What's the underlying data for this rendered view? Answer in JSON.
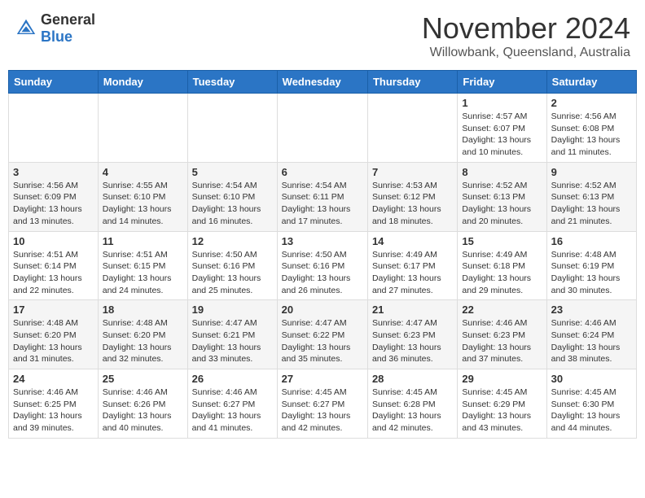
{
  "header": {
    "logo_general": "General",
    "logo_blue": "Blue",
    "month_title": "November 2024",
    "location": "Willowbank, Queensland, Australia"
  },
  "days_of_week": [
    "Sunday",
    "Monday",
    "Tuesday",
    "Wednesday",
    "Thursday",
    "Friday",
    "Saturday"
  ],
  "weeks": [
    [
      {
        "day": "",
        "info": ""
      },
      {
        "day": "",
        "info": ""
      },
      {
        "day": "",
        "info": ""
      },
      {
        "day": "",
        "info": ""
      },
      {
        "day": "",
        "info": ""
      },
      {
        "day": "1",
        "info": "Sunrise: 4:57 AM\nSunset: 6:07 PM\nDaylight: 13 hours and 10 minutes."
      },
      {
        "day": "2",
        "info": "Sunrise: 4:56 AM\nSunset: 6:08 PM\nDaylight: 13 hours and 11 minutes."
      }
    ],
    [
      {
        "day": "3",
        "info": "Sunrise: 4:56 AM\nSunset: 6:09 PM\nDaylight: 13 hours and 13 minutes."
      },
      {
        "day": "4",
        "info": "Sunrise: 4:55 AM\nSunset: 6:10 PM\nDaylight: 13 hours and 14 minutes."
      },
      {
        "day": "5",
        "info": "Sunrise: 4:54 AM\nSunset: 6:10 PM\nDaylight: 13 hours and 16 minutes."
      },
      {
        "day": "6",
        "info": "Sunrise: 4:54 AM\nSunset: 6:11 PM\nDaylight: 13 hours and 17 minutes."
      },
      {
        "day": "7",
        "info": "Sunrise: 4:53 AM\nSunset: 6:12 PM\nDaylight: 13 hours and 18 minutes."
      },
      {
        "day": "8",
        "info": "Sunrise: 4:52 AM\nSunset: 6:13 PM\nDaylight: 13 hours and 20 minutes."
      },
      {
        "day": "9",
        "info": "Sunrise: 4:52 AM\nSunset: 6:13 PM\nDaylight: 13 hours and 21 minutes."
      }
    ],
    [
      {
        "day": "10",
        "info": "Sunrise: 4:51 AM\nSunset: 6:14 PM\nDaylight: 13 hours and 22 minutes."
      },
      {
        "day": "11",
        "info": "Sunrise: 4:51 AM\nSunset: 6:15 PM\nDaylight: 13 hours and 24 minutes."
      },
      {
        "day": "12",
        "info": "Sunrise: 4:50 AM\nSunset: 6:16 PM\nDaylight: 13 hours and 25 minutes."
      },
      {
        "day": "13",
        "info": "Sunrise: 4:50 AM\nSunset: 6:16 PM\nDaylight: 13 hours and 26 minutes."
      },
      {
        "day": "14",
        "info": "Sunrise: 4:49 AM\nSunset: 6:17 PM\nDaylight: 13 hours and 27 minutes."
      },
      {
        "day": "15",
        "info": "Sunrise: 4:49 AM\nSunset: 6:18 PM\nDaylight: 13 hours and 29 minutes."
      },
      {
        "day": "16",
        "info": "Sunrise: 4:48 AM\nSunset: 6:19 PM\nDaylight: 13 hours and 30 minutes."
      }
    ],
    [
      {
        "day": "17",
        "info": "Sunrise: 4:48 AM\nSunset: 6:20 PM\nDaylight: 13 hours and 31 minutes."
      },
      {
        "day": "18",
        "info": "Sunrise: 4:48 AM\nSunset: 6:20 PM\nDaylight: 13 hours and 32 minutes."
      },
      {
        "day": "19",
        "info": "Sunrise: 4:47 AM\nSunset: 6:21 PM\nDaylight: 13 hours and 33 minutes."
      },
      {
        "day": "20",
        "info": "Sunrise: 4:47 AM\nSunset: 6:22 PM\nDaylight: 13 hours and 35 minutes."
      },
      {
        "day": "21",
        "info": "Sunrise: 4:47 AM\nSunset: 6:23 PM\nDaylight: 13 hours and 36 minutes."
      },
      {
        "day": "22",
        "info": "Sunrise: 4:46 AM\nSunset: 6:23 PM\nDaylight: 13 hours and 37 minutes."
      },
      {
        "day": "23",
        "info": "Sunrise: 4:46 AM\nSunset: 6:24 PM\nDaylight: 13 hours and 38 minutes."
      }
    ],
    [
      {
        "day": "24",
        "info": "Sunrise: 4:46 AM\nSunset: 6:25 PM\nDaylight: 13 hours and 39 minutes."
      },
      {
        "day": "25",
        "info": "Sunrise: 4:46 AM\nSunset: 6:26 PM\nDaylight: 13 hours and 40 minutes."
      },
      {
        "day": "26",
        "info": "Sunrise: 4:46 AM\nSunset: 6:27 PM\nDaylight: 13 hours and 41 minutes."
      },
      {
        "day": "27",
        "info": "Sunrise: 4:45 AM\nSunset: 6:27 PM\nDaylight: 13 hours and 42 minutes."
      },
      {
        "day": "28",
        "info": "Sunrise: 4:45 AM\nSunset: 6:28 PM\nDaylight: 13 hours and 42 minutes."
      },
      {
        "day": "29",
        "info": "Sunrise: 4:45 AM\nSunset: 6:29 PM\nDaylight: 13 hours and 43 minutes."
      },
      {
        "day": "30",
        "info": "Sunrise: 4:45 AM\nSunset: 6:30 PM\nDaylight: 13 hours and 44 minutes."
      }
    ]
  ]
}
